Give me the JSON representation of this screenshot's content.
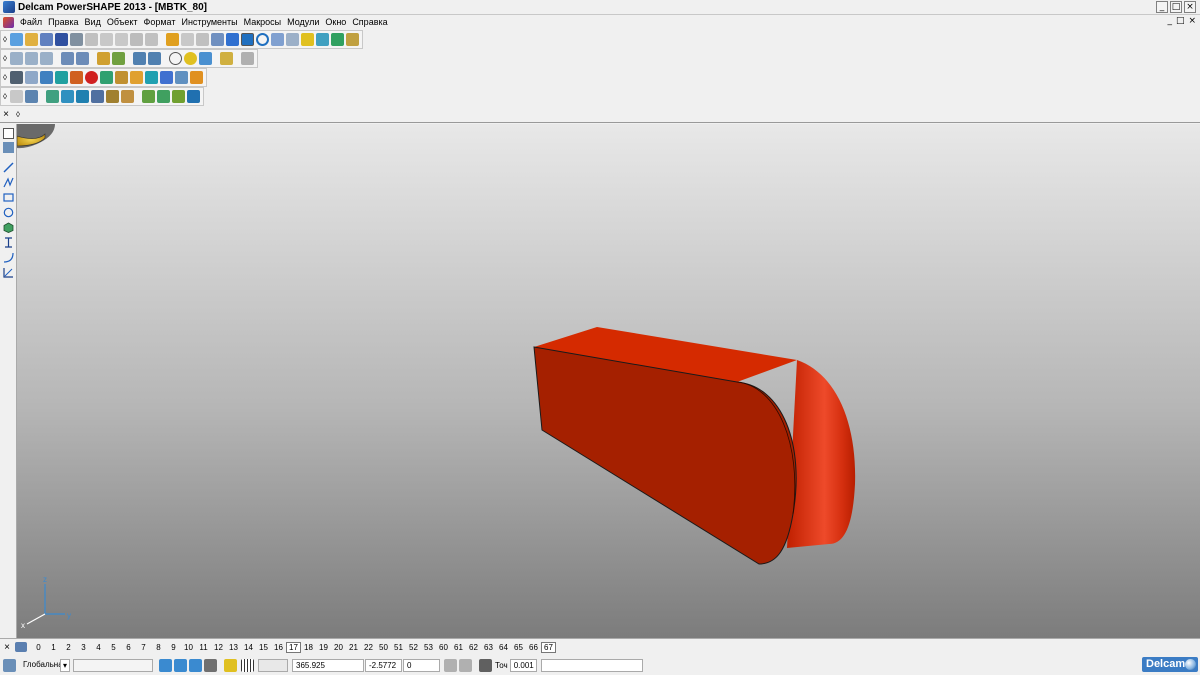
{
  "window": {
    "title": "Delcam PowerSHAPE 2013 - [MBTK_80]",
    "buttons": [
      "_",
      "□",
      "×"
    ],
    "mdi_buttons": [
      "_",
      "□",
      "×"
    ]
  },
  "menu": {
    "items": [
      "Файл",
      "Правка",
      "Вид",
      "Объект",
      "Формат",
      "Инструменты",
      "Макросы",
      "Модули",
      "Окно",
      "Справка"
    ]
  },
  "toolbars": {
    "close_glyph": "×",
    "grip_glyph": "◊"
  },
  "levels": {
    "items": [
      "0",
      "1",
      "2",
      "3",
      "4",
      "5",
      "6",
      "7",
      "8",
      "9",
      "10",
      "11",
      "12",
      "13",
      "14",
      "15",
      "16",
      "17",
      "18",
      "19",
      "20",
      "21",
      "22",
      "50",
      "51",
      "52",
      "53",
      "60",
      "61",
      "62",
      "63",
      "64",
      "65",
      "66",
      "67"
    ],
    "highlighted": [
      "17",
      "67"
    ]
  },
  "status": {
    "workplane": "Глобальна",
    "coord_x": "365.925",
    "coord_y": "-2.5772",
    "coord_z": "0",
    "tolerance_label": "Точ",
    "tolerance_value": "0.001",
    "brand": "Delcam"
  },
  "model": {
    "color": "#cc2200",
    "shape": "extruded-slot"
  },
  "colors": {
    "chrome": "#f0f0f0",
    "viewport_top": "#e8e8e8",
    "viewport_bottom": "#7c7c7c",
    "accent": "#3b7cc4"
  }
}
